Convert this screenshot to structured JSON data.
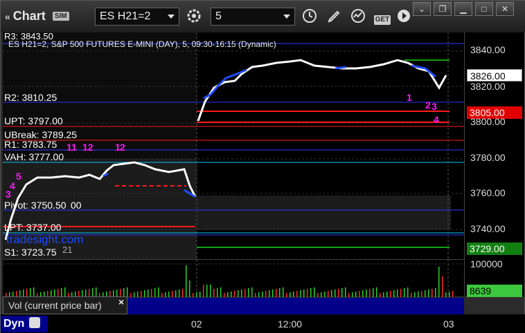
{
  "toolbar": {
    "title": "Chart",
    "sim_badge": "SIM",
    "symbol": "ES H21=2",
    "interval": "5",
    "get_badge": "GET"
  },
  "chart": {
    "header": "ES H21=2, S&P 500 FUTURES E-MINI (DAY), 5, 09:30-16:15 (Dynamic)",
    "top_cutoff_label": "R3: 3843.50",
    "watermark": "tradesight.com",
    "levels": [
      {
        "label": "R2: 3810.25"
      },
      {
        "label": "UPT: 3797.00"
      },
      {
        "label": "UBreak: 3789.25"
      },
      {
        "label": "R1: 3783.75"
      },
      {
        "label": "VAH: 3777.00"
      },
      {
        "label": "Pivot: 3750.50"
      },
      {
        "label": "LPT: 3737.00"
      },
      {
        "label": "S1: 3723.75"
      }
    ],
    "overlap_fragments": [
      "00",
      "21"
    ],
    "count_labels": [
      "11",
      "12",
      "1",
      "2",
      "3",
      "4",
      "5",
      "1",
      "2",
      "3",
      "4"
    ],
    "colors": {
      "blue_line": "#2a3aff",
      "red_line": "#ff1a1a",
      "green_line": "#15a015",
      "magenta": "#ff19ff",
      "green_count": "#2bd22b",
      "bar_white": "#ffffff",
      "bar_blue": "#1e4bff"
    }
  },
  "price_axis": {
    "ticks": [
      "3840.00",
      "3820.00",
      "3800.00",
      "3780.00",
      "3760.00",
      "3740.00"
    ],
    "current_price": "3826.00",
    "red_marker": "3805.00",
    "green_marker": "3729.00"
  },
  "volume": {
    "panel_label": "Vol (current price bar)",
    "close_symbol": "×",
    "axis_top": "100000",
    "current": "8639"
  },
  "time_axis": {
    "ticks": [
      "02",
      "12:00",
      "03"
    ],
    "dyn_label": "Dyn"
  }
}
